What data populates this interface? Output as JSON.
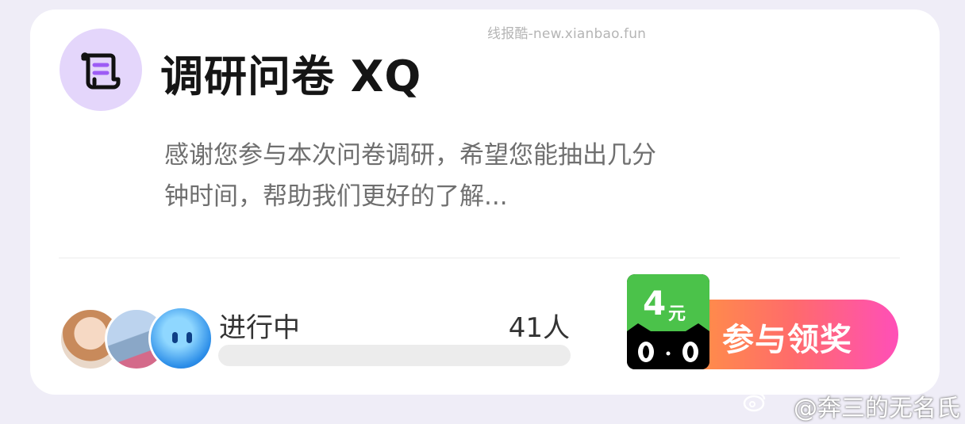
{
  "watermark_top": "线报酷-new.xianbao.fun",
  "survey": {
    "icon": "scroll-icon",
    "title": "调研问卷 XQ",
    "description": "感谢您参与本次问卷调研，希望您能抽出几分钟时间，帮助我们更好的了解..."
  },
  "participants": {
    "avatars": [
      "avatar-girl",
      "avatar-building",
      "avatar-blue-mascot"
    ],
    "status": "进行中",
    "count": "41人",
    "progress": 0
  },
  "cta": {
    "badge_amount": "4",
    "badge_unit": "元",
    "badge_icon": "tmall-cat-icon",
    "label": "参与领奖"
  },
  "watermark_bottom": "@奔三的无名氏",
  "colors": {
    "background": "#efedf7",
    "card": "#ffffff",
    "logo_bg": "#e4d6fb",
    "badge_green": "#4bc24a",
    "cta_gradient": [
      "#ff9a3c",
      "#ff6b6b",
      "#ff4fb8"
    ]
  }
}
